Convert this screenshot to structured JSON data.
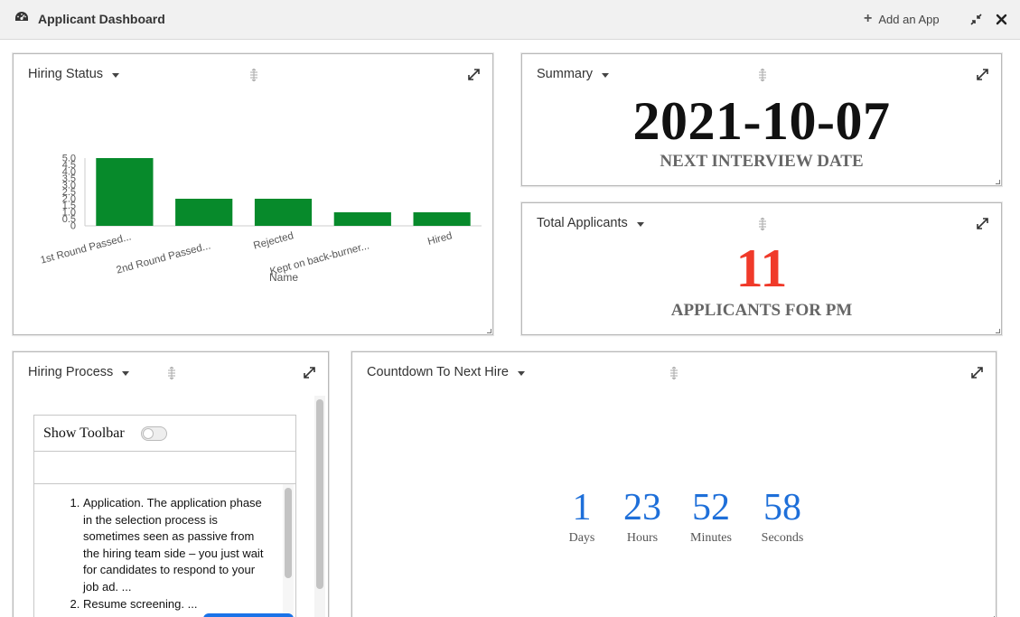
{
  "header": {
    "title": "Applicant Dashboard",
    "add_app_label": "Add an App",
    "icons": {
      "dashboard": "gauge-icon",
      "add": "plus-icon",
      "shrink": "compress-icon",
      "close": "close-icon"
    }
  },
  "panels": {
    "hiring_status": {
      "title": "Hiring Status"
    },
    "summary": {
      "title": "Summary",
      "value": "2021-10-07",
      "caption": "NEXT INTERVIEW DATE"
    },
    "total_applicants": {
      "title": "Total Applicants",
      "value": "11",
      "caption": "APPLICANTS FOR PM",
      "value_color": "#f03a2a"
    },
    "hiring_process": {
      "title": "Hiring Process",
      "toolbar_label": "Show Toolbar",
      "items": [
        "Application. The application phase in the selection process is sometimes seen as passive from the hiring team side – you just wait for candidates to respond to your job ad. ...",
        "Resume screening. ..."
      ]
    },
    "countdown": {
      "title": "Countdown To Next Hire",
      "units": [
        {
          "value": "1",
          "label": "Days"
        },
        {
          "value": "23",
          "label": "Hours"
        },
        {
          "value": "52",
          "label": "Minutes"
        },
        {
          "value": "58",
          "label": "Seconds"
        }
      ],
      "color": "#1e6fd9"
    }
  },
  "chart_data": {
    "type": "bar",
    "categories": [
      "1st Round Passed...",
      "2nd Round Passed...",
      "Rejected",
      "Kept on back-burner...",
      "Hired"
    ],
    "values": [
      5,
      2,
      2,
      1,
      1
    ],
    "xlabel": "Name",
    "ylabel": "",
    "ylim": [
      0,
      5
    ],
    "yticks": [
      "0",
      "0.5",
      "1.0",
      "1.5",
      "2.0",
      "2.5",
      "3.0",
      "3.5",
      "4.0",
      "4.5",
      "5.0"
    ],
    "bar_color": "#078a2b",
    "grid": false
  }
}
